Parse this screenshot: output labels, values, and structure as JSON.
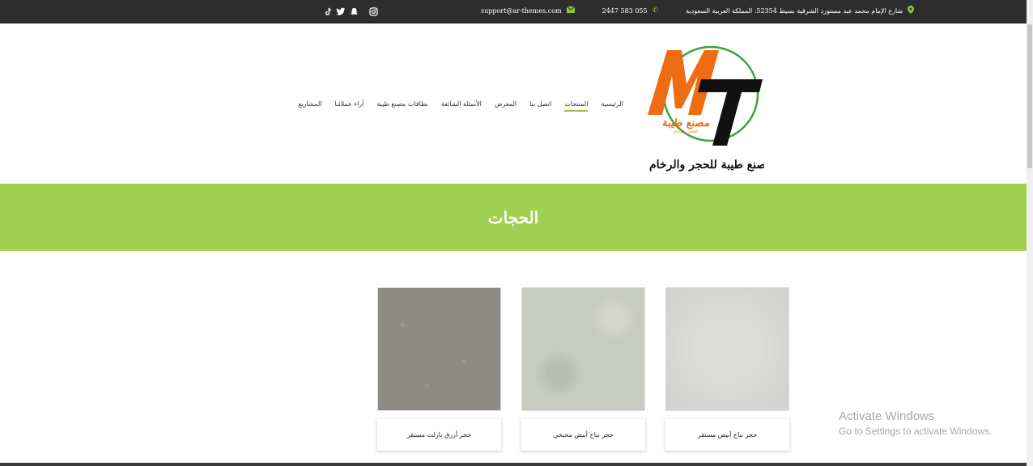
{
  "topbar": {
    "address": "شارع الإمام محمد عبد مستورد الشرقية بسيط 52354، المملكة العربية السعودية",
    "phone": "2447 583 055",
    "email": "support@ar-themes.com",
    "social_icons": [
      "instagram-icon",
      "twitter-icon",
      "snapchat-icon",
      "tiktok-icon"
    ]
  },
  "logo": {
    "letters": "MT",
    "arabic_small": "مصنع طيبة",
    "arabic_tiny": "للحجر والرخام",
    "arabic_title": "مصنع طيبة للحجر والرخام"
  },
  "nav": {
    "items": [
      {
        "label": "الرئيسية",
        "active": false
      },
      {
        "label": "المنتجات",
        "active": true
      },
      {
        "label": "اتصل بنا",
        "active": false
      },
      {
        "label": "المعرض",
        "active": false
      },
      {
        "label": "الأسئلة الشائعة",
        "active": false
      },
      {
        "label": "بطاقات مصنع طيبة",
        "active": false
      },
      {
        "label": "آراء عملائنا",
        "active": false
      },
      {
        "label": "المشاريع",
        "active": false
      }
    ]
  },
  "banner": {
    "title": "الحجات"
  },
  "products": [
    {
      "name": "حجر نباح أبيض مستقر",
      "color": "#d6d6d4"
    },
    {
      "name": "حجر نباح أبيض محبحي",
      "color": "#c8cbc2"
    },
    {
      "name": "حجر أزرق بازلت مستقر",
      "color": "#8e8a86"
    }
  ],
  "watermark": {
    "line1": "Activate Windows",
    "line2": "Go to Settings to activate Windows."
  },
  "colors": {
    "topbar": "#2d2d2d",
    "accent_green": "#a0d050",
    "logo_orange": "#f06c12",
    "logo_green_ring": "#3aa63a"
  }
}
